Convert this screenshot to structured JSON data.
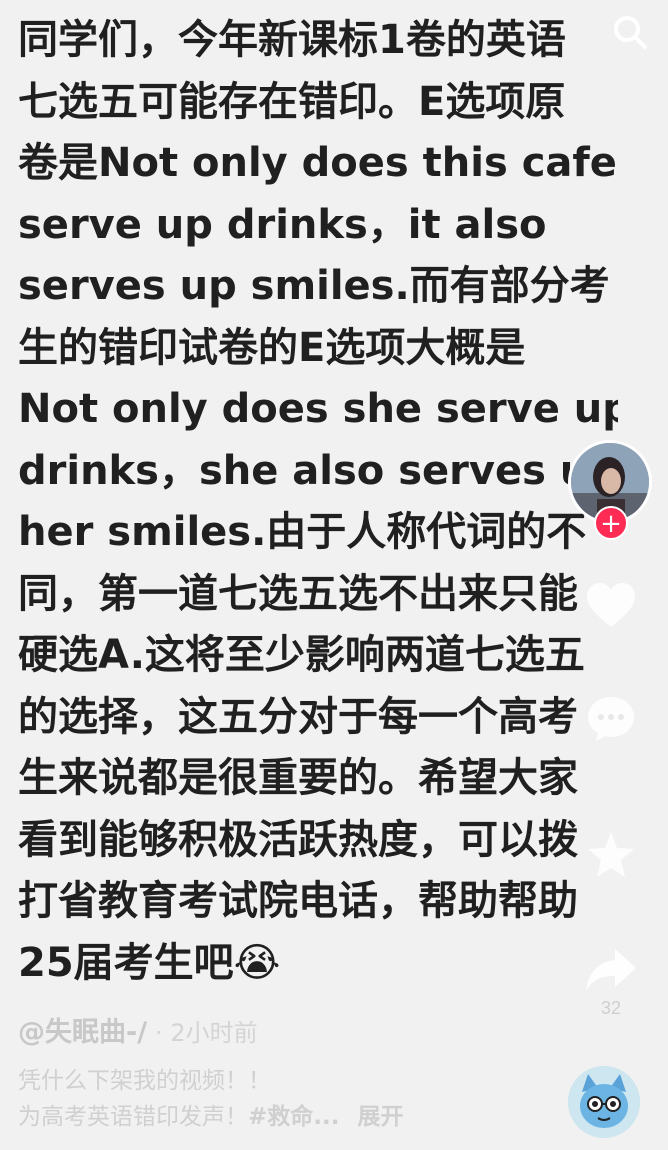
{
  "post": {
    "lines": [
      "同学们，今年新课标1卷的英语",
      "七选五可能存在错印。E选项原",
      "卷是Not only does this cafe",
      "serve up drinks，it also",
      "serves up smiles.而有部分考",
      "生的错印试卷的E选项大概是",
      "Not only does she serve up",
      "drinks，she also serves up",
      "her smiles.由于人称代词的不",
      "同，第一道七选五选不出来只能",
      "硬选A.这将至少影响两道七选五",
      "的选择，这五分对于每一个高考",
      "生来说都是很重要的。希望大家",
      "看到能够积极活跃热度，可以拨",
      "打省教育考试院电话，帮助帮助",
      "25届考生吧😭"
    ]
  },
  "sidebar": {
    "share_count": "32"
  },
  "footer": {
    "author": "@失眠曲-/",
    "time": "· 2小时前",
    "desc_line1": "凭什么下架我的视频！！",
    "desc_line2": "为高考英语错印发声！",
    "hashtag": "#救命...",
    "expand_label": "展开"
  },
  "colors": {
    "text": "#202020",
    "background": "#f1f1f1",
    "follow": "#fe2c55"
  }
}
